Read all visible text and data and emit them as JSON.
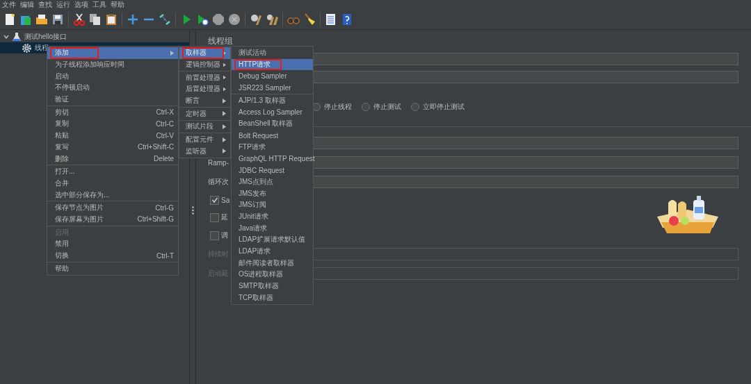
{
  "menu_bar": [
    "文件",
    "编辑",
    "查找",
    "运行",
    "选项",
    "工具",
    "帮助"
  ],
  "tree": [
    {
      "label": "测试hello接口",
      "kind": "plan",
      "expanded": true,
      "selected": false,
      "children": [
        {
          "label": "线程",
          "kind": "thread",
          "selected": true
        }
      ]
    }
  ],
  "panel": {
    "title": "线程组",
    "radios": [
      {
        "label": "停止线程",
        "selected": false
      },
      {
        "label": "停止测试",
        "selected": false
      },
      {
        "label": "立即停止测试",
        "selected": false
      }
    ],
    "field_labels": [
      {
        "label": "Ramp-",
        "disabled": false
      },
      {
        "label": "循环次",
        "disabled": false
      }
    ],
    "checkboxes": [
      {
        "label": "Sa",
        "checked": true
      },
      {
        "label": "延",
        "checked": false
      },
      {
        "label": "调",
        "checked": false
      }
    ],
    "lower_labels": [
      {
        "label": "持续时",
        "disabled": true
      },
      {
        "label": "启动延",
        "disabled": true
      }
    ]
  },
  "context_menu": [
    [
      {
        "label": "添加",
        "submenu": true,
        "selected": true,
        "highlighted": true
      },
      {
        "label": "为子线程添加响应时间"
      },
      {
        "label": "启动"
      },
      {
        "label": "不停顿启动"
      },
      {
        "label": "验证"
      }
    ],
    [
      {
        "label": "剪切",
        "shortcut": "Ctrl-X"
      },
      {
        "label": "复制",
        "shortcut": "Ctrl-C"
      },
      {
        "label": "粘贴",
        "shortcut": "Ctrl-V"
      },
      {
        "label": "复写",
        "shortcut": "Ctrl+Shift-C"
      },
      {
        "label": "删除",
        "shortcut": "Delete"
      }
    ],
    [
      {
        "label": "打开..."
      },
      {
        "label": "合并"
      },
      {
        "label": "选中部分保存为..."
      }
    ],
    [
      {
        "label": "保存节点为图片",
        "shortcut": "Ctrl-G"
      },
      {
        "label": "保存屏幕为图片",
        "shortcut": "Ctrl+Shift-G"
      }
    ],
    [
      {
        "label": "启用",
        "disabled": true
      },
      {
        "label": "禁用"
      },
      {
        "label": "切换",
        "shortcut": "Ctrl-T"
      }
    ],
    [
      {
        "label": "帮助"
      }
    ]
  ],
  "add_menu": [
    [
      {
        "label": "取样器",
        "submenu": true,
        "selected": true,
        "highlighted": true
      },
      {
        "label": "逻辑控制器",
        "submenu": true
      }
    ],
    [
      {
        "label": "前置处理器",
        "submenu": true
      },
      {
        "label": "后置处理器",
        "submenu": true
      },
      {
        "label": "断言",
        "submenu": true
      }
    ],
    [
      {
        "label": "定时器",
        "submenu": true
      }
    ],
    [
      {
        "label": "测试片段",
        "submenu": true
      }
    ],
    [
      {
        "label": "配置元件",
        "submenu": true
      },
      {
        "label": "监听器",
        "submenu": true
      }
    ]
  ],
  "sampler_menu": [
    [
      {
        "label": "测试活动"
      },
      {
        "label": "HTTP请求",
        "selected": true,
        "highlighted": true
      },
      {
        "label": "Debug Sampler"
      },
      {
        "label": "JSR223 Sampler"
      }
    ],
    [
      {
        "label": "AJP/1.3 取样器"
      },
      {
        "label": "Access Log Sampler"
      },
      {
        "label": "BeanShell 取样器"
      },
      {
        "label": "Bolt Request"
      },
      {
        "label": "FTP请求"
      },
      {
        "label": "GraphQL HTTP Request"
      },
      {
        "label": "JDBC Request"
      },
      {
        "label": "JMS点到点"
      },
      {
        "label": "JMS发布"
      },
      {
        "label": "JMS订阅"
      },
      {
        "label": "JUnit请求"
      },
      {
        "label": "Java请求"
      },
      {
        "label": "LDAP扩展请求默认值"
      },
      {
        "label": "LDAP请求"
      },
      {
        "label": "邮件阅读者取样器"
      },
      {
        "label": "OS进程取样器"
      },
      {
        "label": "SMTP取样器"
      },
      {
        "label": "TCP取样器"
      }
    ]
  ]
}
